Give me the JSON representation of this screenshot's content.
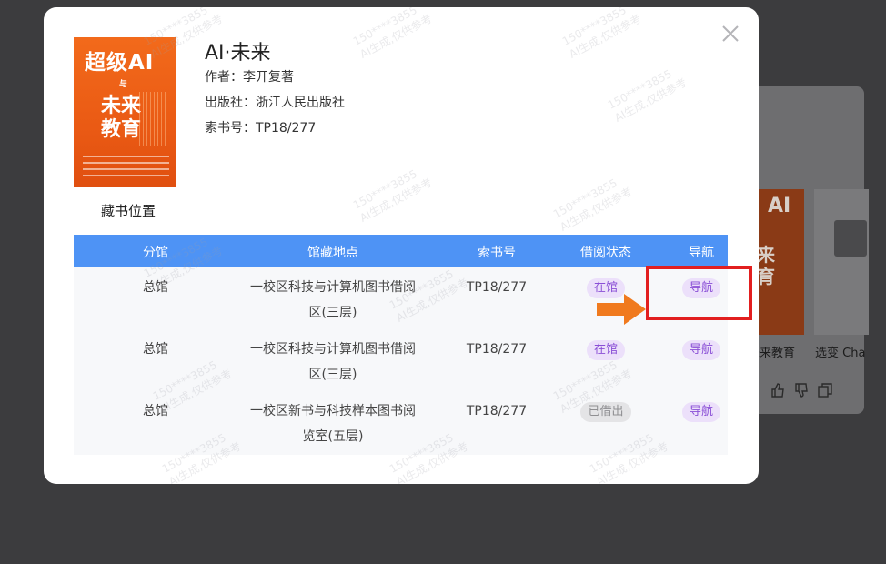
{
  "background_page": {
    "book1_title": "未来教育",
    "book2_title": "选变 Cha",
    "book1_cover_text_top": "AI",
    "book1_cover_text_mid": "来\n育"
  },
  "modal": {
    "close_icon": "close-icon",
    "cover": {
      "line1": "超级AI",
      "line2": "与",
      "line3": "未来\n教育"
    },
    "location_label": "藏书位置",
    "book": {
      "title": "AI·未来",
      "author": "作者：李开复著",
      "publisher": "出版社：浙江人民出版社",
      "call_number": "索书号：TP18/277"
    },
    "table": {
      "headers": [
        "分馆",
        "馆藏地点",
        "索书号",
        "借阅状态",
        "导航"
      ],
      "rows": [
        {
          "branch": "总馆",
          "location_line1": "一校区科技与计算机图书借阅",
          "location_line2": "区(三层)",
          "call_no": "TP18/277",
          "status": "在馆",
          "status_kind": "in",
          "nav": "导航"
        },
        {
          "branch": "总馆",
          "location_line1": "一校区科技与计算机图书借阅",
          "location_line2": "区(三层)",
          "call_no": "TP18/277",
          "status": "在馆",
          "status_kind": "in",
          "nav": "导航"
        },
        {
          "branch": "总馆",
          "location_line1": "一校区新书与科技样本图书阅",
          "location_line2": "览室(五层)",
          "call_no": "TP18/277",
          "status": "已借出",
          "status_kind": "out",
          "nav": "导航"
        }
      ]
    }
  },
  "watermark": {
    "line1": "150****3855",
    "line2": "AI生成,仅供参考"
  },
  "colors": {
    "table_header": "#4e93f5",
    "highlight": "#e21f1f",
    "arrow": "#f07a1e",
    "pill_purple": "#8a4fd6",
    "cover_orange": "#ea5a14"
  }
}
